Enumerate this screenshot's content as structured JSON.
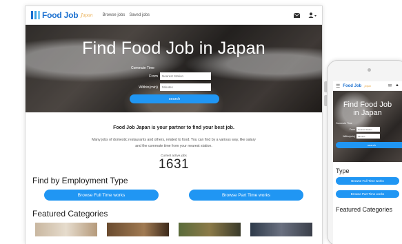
{
  "brand": {
    "name": "Food Job",
    "script": "Japan"
  },
  "nav": {
    "links": [
      "Browse jobs",
      "Saved jobs"
    ]
  },
  "hero": {
    "title": "Find Food Job in Japan",
    "commute_label": "Commute Time",
    "from_label": "From",
    "from_placeholder": "Nearest Station",
    "within_label": "Within(min)",
    "within_placeholder": "Minutes",
    "search_label": "search"
  },
  "intro": {
    "tagline": "Food Job Japan is your partner to find your best job.",
    "desc_line1": "Many jobs of domestic restaurants and others, related to food. You can find by a various way, like salary",
    "desc_line2": "and the commute time from your nearest station.",
    "count_label": "Current active jobs",
    "count": "1631"
  },
  "employment": {
    "title": "Find by Employment Type",
    "full_time": "Browse Full Time works",
    "part_time": "Browse Part Time works"
  },
  "featured": {
    "title": "Featured Categories"
  },
  "phone": {
    "title_line1": "Find Food Job",
    "title_line2": "in Japan",
    "commute_label": "Commute Time",
    "from_label": "From",
    "from_placeholder": "Nearest Station",
    "within_label": "Within(min)",
    "within_placeholder": "Minutes",
    "search_label": "search",
    "type_title": "Type",
    "full_time": "Browse Full Time works",
    "part_time": "Browse Part Time works",
    "featured_title": "Featured Categories"
  },
  "colors": {
    "accent": "#2096f3",
    "brand": "#1a6fcf"
  },
  "icons": {
    "mail": "envelope-icon",
    "user": "user-icon",
    "menu": "hamburger-icon"
  }
}
